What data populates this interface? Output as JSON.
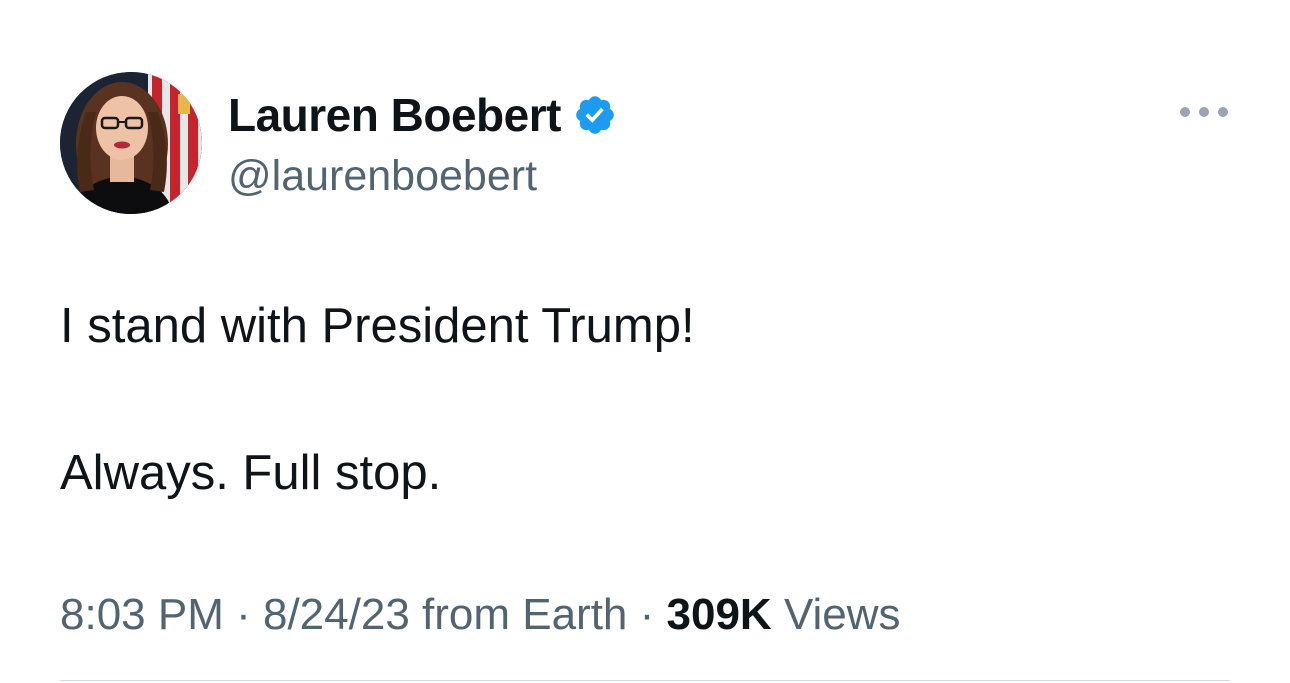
{
  "tweet": {
    "author": {
      "display_name": "Lauren Boebert",
      "handle": "@laurenboebert",
      "verified_icon": "verified-badge-icon",
      "avatar": "profile-photo"
    },
    "more_icon": "more-options-icon",
    "text_lines": [
      "I stand with President Trump!",
      "Always. Full stop."
    ],
    "meta": {
      "time": "8:03 PM",
      "separator": " · ",
      "date_source": "8/24/23 from Earth",
      "views_count": "309K",
      "views_label": "Views"
    }
  },
  "colors": {
    "text_primary": "#0f1419",
    "text_secondary": "#536471",
    "verified_blue": "#1d9bf0",
    "divider": "#cfd9de"
  }
}
